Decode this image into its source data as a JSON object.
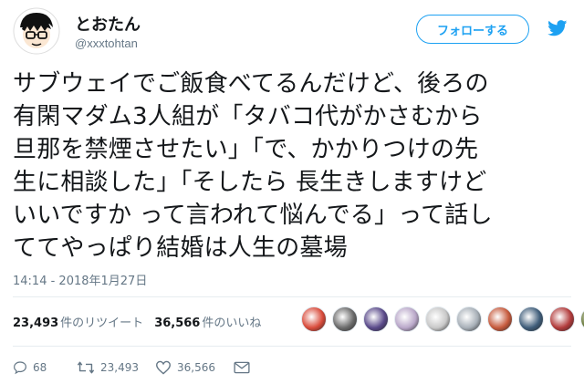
{
  "header": {
    "display_name": "とおたん",
    "handle": "@xxxtohtan",
    "follow_label": "フォローする",
    "brand_color": "#1da1f2"
  },
  "tweet": {
    "lines": [
      "サブウェイでご飯食べてるんだけど、後ろの",
      "有閑マダム3人組が「タバコ代がかさむから",
      "旦那を禁煙させたい」「で、かかりつけの先",
      "生に相談した」「そしたら 長生きしますけど",
      "いいですか って言われて悩んでる」って話し",
      "ててやっぱり結婚は人生の墓場"
    ],
    "timestamp": "14:14 - 2018年1月27日"
  },
  "stats": {
    "retweets_count": "23,493",
    "retweets_label": "件のリツイート",
    "likes_count": "36,566",
    "likes_label": "件のいいね",
    "liker_avatars": [
      "#d94b3b",
      "#6b6b6b",
      "#5a4a8a",
      "#b9a7c9",
      "#c8c8c8",
      "#a8b0b8",
      "#c65a3c",
      "#3f5d7a",
      "#b23b3b",
      "#6a7a3a"
    ]
  },
  "actions": {
    "reply_count": "68",
    "retweet_count": "23,493",
    "like_count": "36,566",
    "icons": [
      "reply-icon",
      "retweet-icon",
      "like-icon",
      "dm-icon"
    ]
  }
}
